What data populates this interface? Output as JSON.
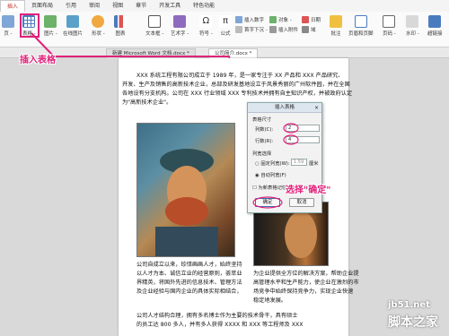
{
  "menu": {
    "tabs": [
      "插入",
      "页面布局",
      "引用",
      "审阅",
      "视图",
      "章节",
      "开发工具",
      "特色功能"
    ]
  },
  "ribbon": {
    "page": "页 -",
    "table": "表格 -",
    "picture": "图片 -",
    "online_picture": "在线图片",
    "shape": "形状 -",
    "chart": "图表",
    "textbox": "文本框 -",
    "art": "艺术字 -",
    "symbol": "符号 -",
    "formula": "公式",
    "insert_number": "插入数字",
    "object": "对象 -",
    "date": "日期",
    "first_letter": "首字下沉 -",
    "attachment": "插入附件",
    "field": "域",
    "comment": "批注",
    "header_footer": "页眉和页脚",
    "page_number": "页码 -",
    "watermark": "水印 -",
    "hyperlink": "超链接"
  },
  "doc_tabs": {
    "tab1": "新建 Microsoft Word 文档.docx *",
    "tab2": "公司简介.docx *"
  },
  "document": {
    "para1": [
      "XXX 系统工程有限公司成立于 1989 年，是一家专注于 XX 产品和 XXX 产品研究、",
      "开发、生产及销售的高新技术企业，总部及研发基地设立于风景秀丽的广州软件园，并在全国",
      "各地设有分支机构。公司在 XXX 行业领域 XXX 专利技术并拥有自主知识产权，并被政府认定",
      "为\"高新技术企业\"。"
    ],
    "col_left": [
      "公司自成立以来，珍惜画画人才，始终坚持",
      "以人才为本、诚信立业的经营原则，荟萃业",
      "界精英，将国外先进的信息技术、管理方法",
      "及企业经验与国内企业的具体实际相结合，"
    ],
    "col_right": [
      "为企业提供全方位的解决方案，帮助企业提",
      "高管理水平和生产能力，使企业在激烈的市",
      "场竞争中始终保持竞争力，实现企业快速",
      "稳定地发展。"
    ],
    "para3": [
      "公司人才结构合理，拥有多名博士作为主要的技术骨干，具有硕士",
      "的员工达 800 多人，并有多人获得 XXXX 和 XXX 等工程师及 XXX"
    ]
  },
  "dialog": {
    "title": "插入表格",
    "close": "×",
    "size_group": "表格尺寸",
    "cols_label": "列数(C):",
    "cols_value": "2",
    "rows_label": "行数(R):",
    "rows_value": "4",
    "width_group": "列宽选择",
    "fixed_label": "固定列宽(W):",
    "fixed_value": "1.59",
    "fixed_unit": "厘米",
    "auto_label": "自动列宽(F)",
    "remember_label": "为新表格记忆此尺寸(S)",
    "ok": "确定",
    "cancel": "取消"
  },
  "annotations": {
    "insert_table": "插入表格",
    "choose_ok": "选择\"确定\""
  },
  "watermark": {
    "site": "jb51.net",
    "name": "脚本之家"
  },
  "colors": {
    "annotation": "#e0207a",
    "ribbon_bg": "#fafafa",
    "dialog_title_bg": "#dde6ef"
  }
}
